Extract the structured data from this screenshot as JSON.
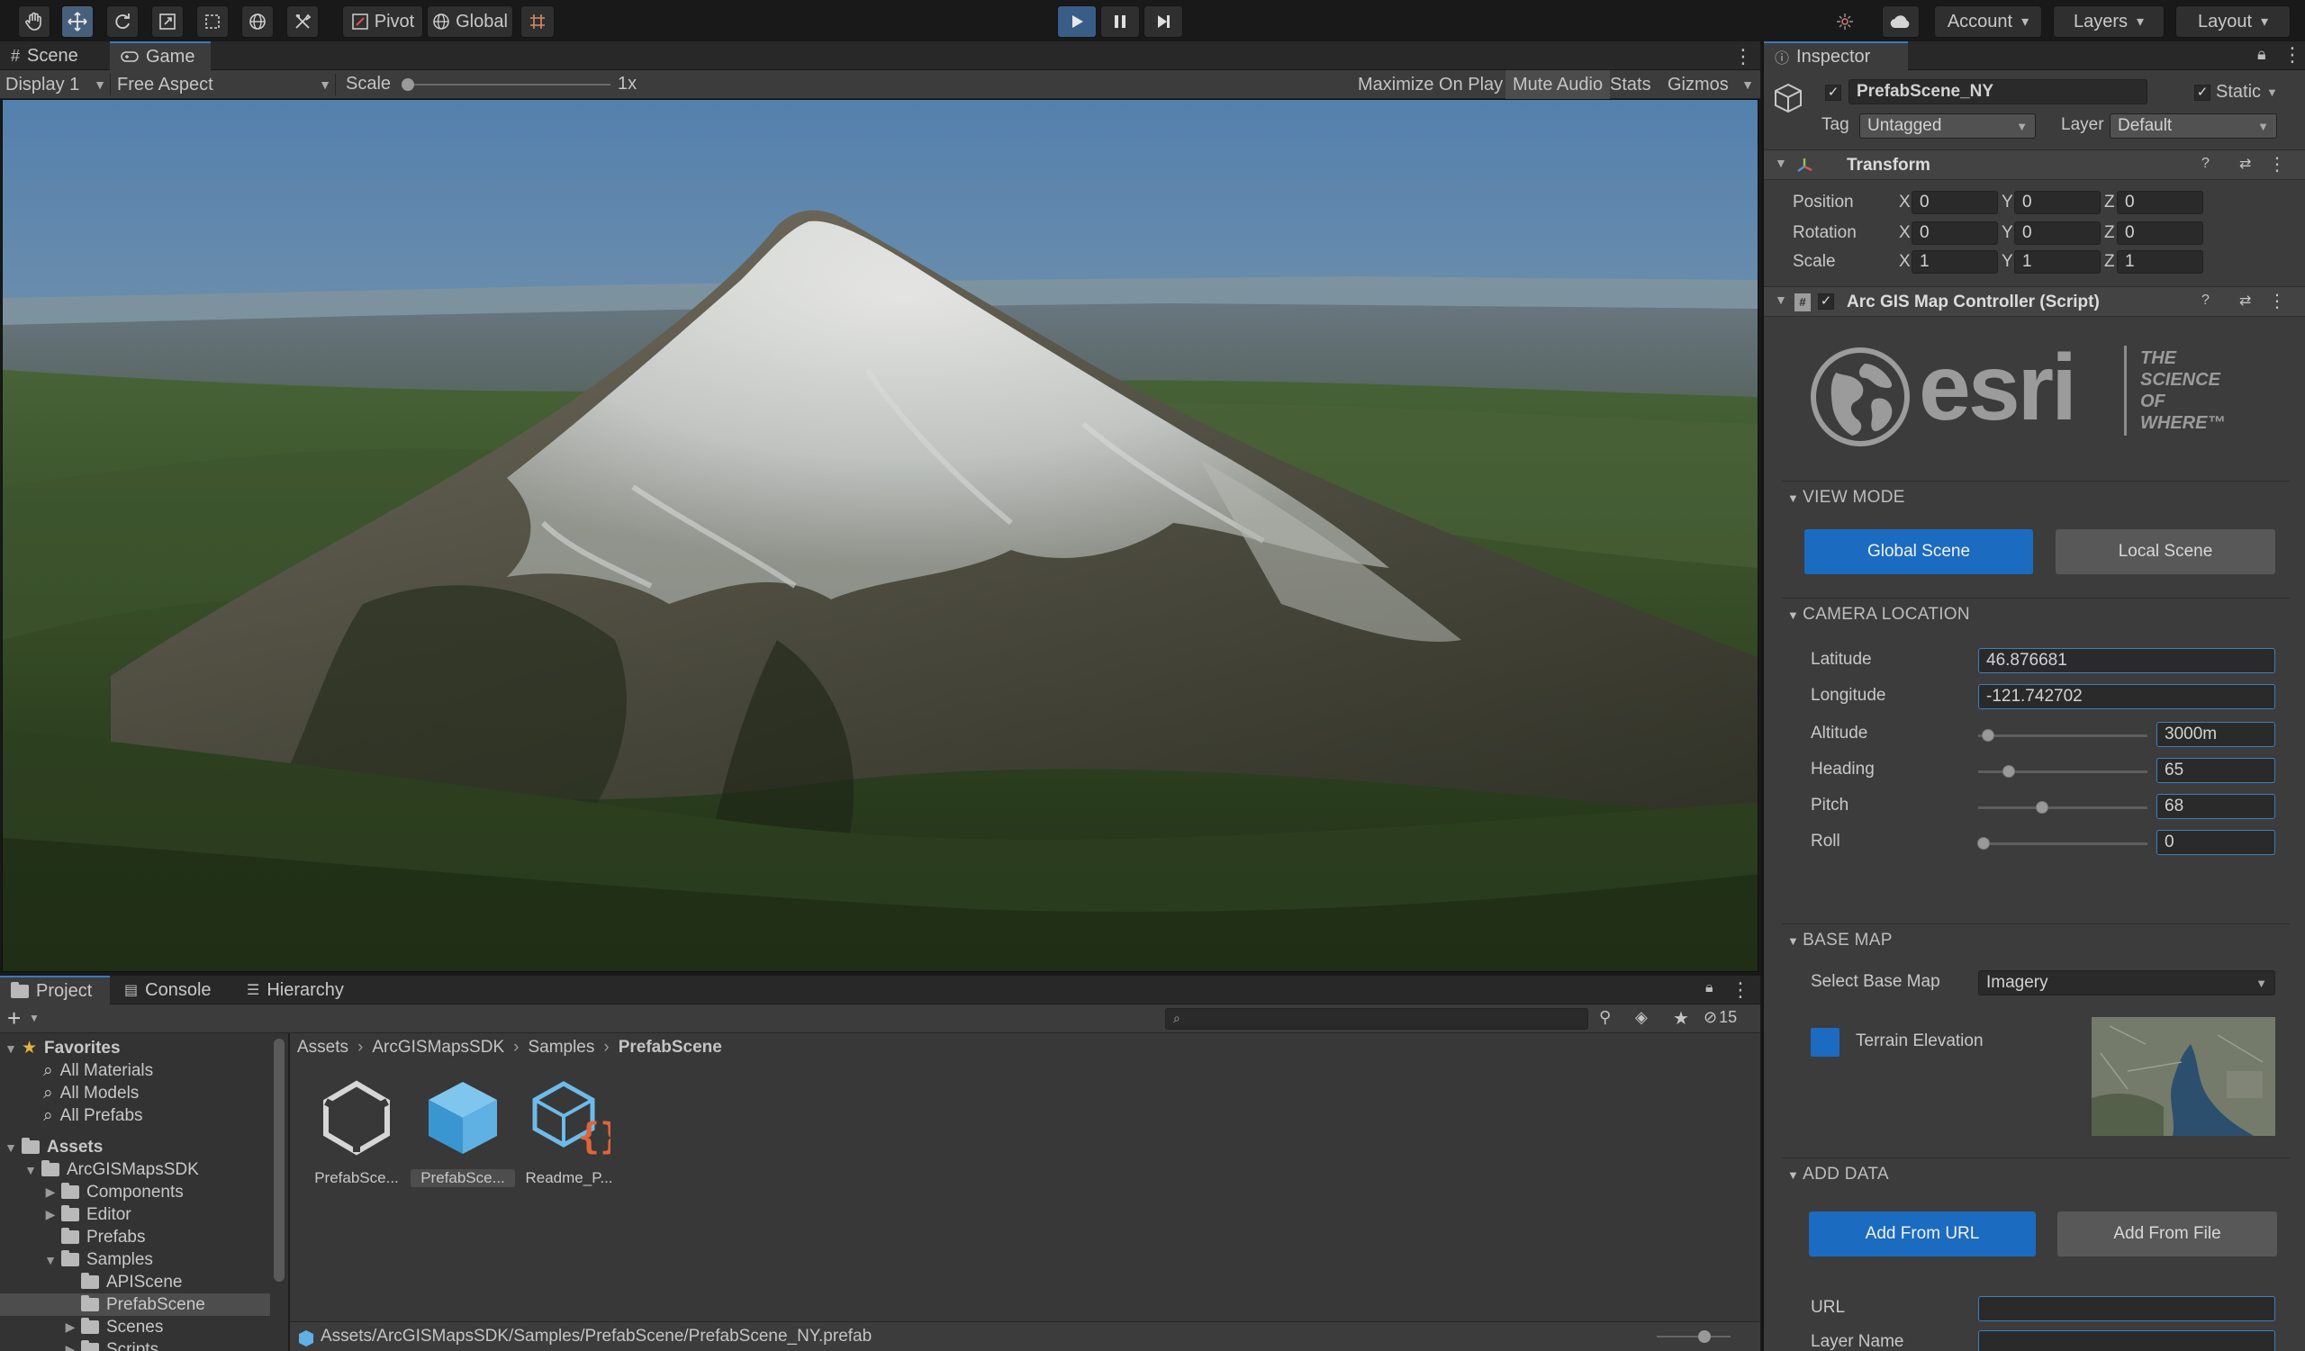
{
  "toolbar": {
    "pivot": "Pivot",
    "global": "Global",
    "account": "Account",
    "layers": "Layers",
    "layout": "Layout"
  },
  "tabs": {
    "scene": "Scene",
    "game": "Game",
    "inspector": "Inspector",
    "project": "Project",
    "console": "Console",
    "hierarchy": "Hierarchy"
  },
  "gamebar": {
    "display": "Display 1",
    "aspect": "Free Aspect",
    "scale_label": "Scale",
    "scale_value": "1x",
    "scale_fraction": 0.0,
    "maximize": "Maximize On Play",
    "mute": "Mute Audio",
    "stats": "Stats",
    "gizmos": "Gizmos"
  },
  "inspector": {
    "object_name": "PrefabScene_NY",
    "static": "Static",
    "tag_label": "Tag",
    "tag_value": "Untagged",
    "layer_label": "Layer",
    "layer_value": "Default",
    "transform": {
      "title": "Transform",
      "position_label": "Position",
      "rotation_label": "Rotation",
      "scale_label": "Scale",
      "x": "X",
      "y": "Y",
      "z": "Z",
      "position": [
        "0",
        "0",
        "0"
      ],
      "rotation": [
        "0",
        "0",
        "0"
      ],
      "scale": [
        "1",
        "1",
        "1"
      ]
    },
    "script": {
      "title": "Arc GIS Map Controller (Script)",
      "logo_text": "esri",
      "tagline": [
        "THE",
        "SCIENCE",
        "OF",
        "WHERE™"
      ]
    },
    "view_mode": {
      "title": "VIEW MODE",
      "global": "Global Scene",
      "local": "Local Scene"
    },
    "camera": {
      "title": "CAMERA LOCATION",
      "latitude_label": "Latitude",
      "latitude": "46.876681",
      "longitude_label": "Longitude",
      "longitude": "-121.742702",
      "altitude_label": "Altitude",
      "altitude": "3000m",
      "altitude_fraction": 0.06,
      "heading_label": "Heading",
      "heading": "65",
      "heading_fraction": 0.18,
      "pitch_label": "Pitch",
      "pitch": "68",
      "pitch_fraction": 0.38,
      "roll_label": "Roll",
      "roll": "0",
      "roll_fraction": 0.03
    },
    "basemap": {
      "title": "BASE MAP",
      "select_label": "Select Base Map",
      "select_value": "Imagery",
      "terrain_label": "Terrain Elevation"
    },
    "add_data": {
      "title": "ADD DATA",
      "from_url": "Add From URL",
      "from_file": "Add From File",
      "url_label": "URL",
      "layer_name_label": "Layer Name",
      "url_value": "",
      "layer_name_value": ""
    }
  },
  "project": {
    "hidden_count": "15",
    "search_placeholder": "",
    "breadcrumb": [
      "Assets",
      "ArcGISMapsSDK",
      "Samples",
      "PrefabScene"
    ],
    "favorites": {
      "title": "Favorites",
      "items": [
        "All Materials",
        "All Models",
        "All Prefabs"
      ]
    },
    "assets_title": "Assets",
    "tree": {
      "sdk": "ArcGISMapsSDK",
      "components": "Components",
      "editor": "Editor",
      "prefabs": "Prefabs",
      "samples": "Samples",
      "apiscene": "APIScene",
      "prefabscene": "PrefabScene",
      "scenes": "Scenes",
      "scripts": "Scripts"
    },
    "assets": [
      "PrefabSce...",
      "PrefabSce...",
      "Readme_P..."
    ],
    "status_path": "Assets/ArcGISMapsSDK/Samples/PrefabScene/PrefabScene_NY.prefab"
  },
  "colors": {
    "accent_blue": "#1b6bc0",
    "panel_bg": "#3c3c3c",
    "toolbar_bg": "#191919",
    "sky_top": "#5d8ab5",
    "terrain_green": "#3f5a2c"
  }
}
